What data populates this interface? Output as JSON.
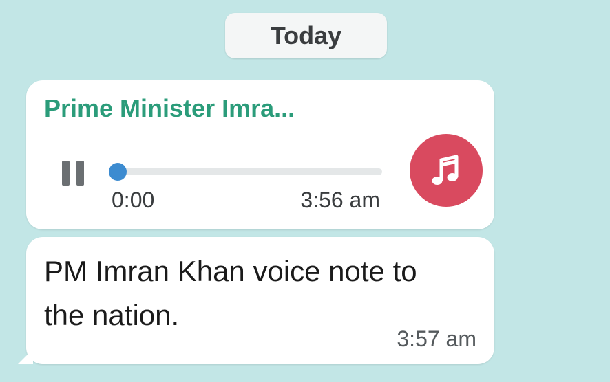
{
  "date_divider": {
    "label": "Today"
  },
  "audio_message": {
    "sender": "Prime Minister Imra...",
    "elapsed": "0:00",
    "progress": 0.0,
    "timestamp": "3:56 am",
    "badge_icon": "music-note-icon",
    "badge_color": "#d94a5f",
    "play_state": "pause-icon"
  },
  "text_message": {
    "text": "PM Imran Khan voice note to the nation.",
    "timestamp": "3:57 am"
  },
  "colors": {
    "background": "#c2e6e6",
    "sender_name": "#2b9c7a",
    "progress_accent": "#3c8bd0"
  }
}
